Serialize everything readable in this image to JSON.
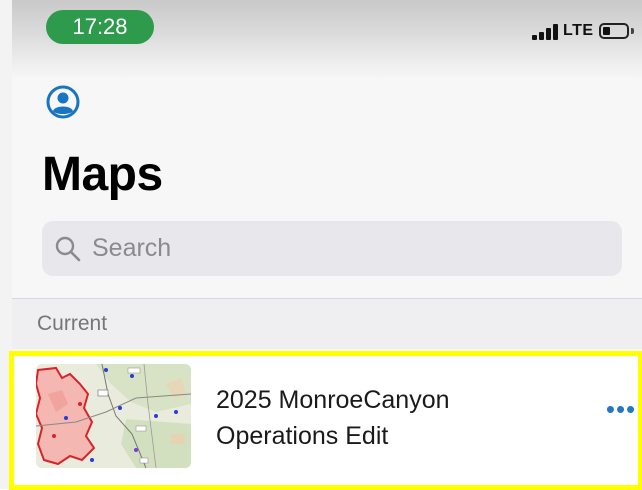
{
  "status_bar": {
    "time": "17:28",
    "network": "LTE",
    "accent_time": "#2e9a4c"
  },
  "header": {
    "account_icon": "person-circle-icon",
    "title": "Maps"
  },
  "search": {
    "placeholder": "Search",
    "icon": "search-icon"
  },
  "sections": [
    {
      "label": "Current",
      "items": [
        {
          "name": "2025 MonroeCanyon Operations Edit",
          "thumbnail": "map-thumbnail",
          "action_icon": "more-icon"
        }
      ]
    }
  ],
  "colors": {
    "accent": "#1a74c4",
    "highlight": "#ffff00",
    "fire_perimeter": "#d8232a"
  }
}
